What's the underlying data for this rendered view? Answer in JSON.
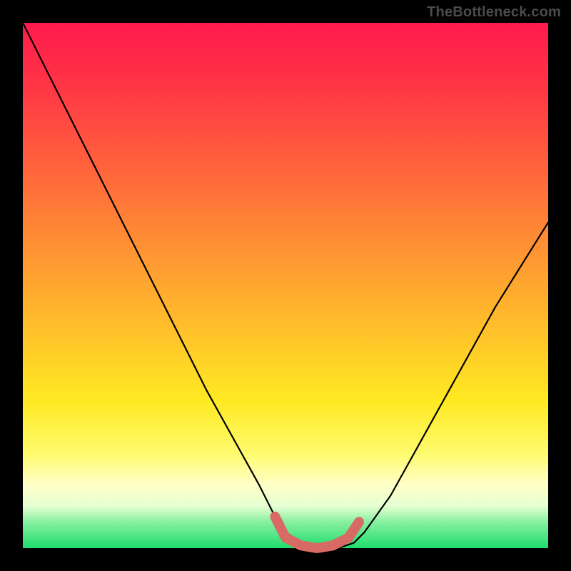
{
  "watermark": "TheBottleneck.com",
  "chart_data": {
    "type": "line",
    "title": "",
    "xlabel": "",
    "ylabel": "",
    "xlim": [
      0,
      100
    ],
    "ylim": [
      0,
      100
    ],
    "grid": false,
    "series": [
      {
        "name": "bottleneck-curve",
        "color": "#000000",
        "x": [
          0,
          5,
          10,
          15,
          20,
          25,
          30,
          35,
          40,
          45,
          48,
          50,
          55,
          60,
          63,
          65,
          70,
          75,
          80,
          85,
          90,
          95,
          100
        ],
        "y": [
          100,
          90,
          80,
          70,
          60,
          50,
          40,
          30,
          21,
          12,
          6,
          3,
          0,
          0,
          1,
          3,
          10,
          19,
          28,
          37,
          46,
          54,
          62
        ]
      },
      {
        "name": "optimal-band",
        "color": "#d86a66",
        "x": [
          48,
          50,
          53,
          56,
          59,
          62,
          64
        ],
        "y": [
          6,
          2,
          0.5,
          0,
          0.5,
          2,
          5
        ]
      }
    ],
    "gradient_stops": [
      {
        "pos": 0,
        "color": "#ff1a4d"
      },
      {
        "pos": 12,
        "color": "#ff3545"
      },
      {
        "pos": 24,
        "color": "#ff593e"
      },
      {
        "pos": 36,
        "color": "#ff7d37"
      },
      {
        "pos": 48,
        "color": "#ffa130"
      },
      {
        "pos": 60,
        "color": "#ffc529"
      },
      {
        "pos": 72,
        "color": "#ffe922"
      },
      {
        "pos": 82,
        "color": "#fffb6e"
      },
      {
        "pos": 88,
        "color": "#ffffc8"
      },
      {
        "pos": 92,
        "color": "#e6ffd2"
      },
      {
        "pos": 95,
        "color": "#88f0a0"
      },
      {
        "pos": 100,
        "color": "#1fdc6e"
      }
    ]
  }
}
